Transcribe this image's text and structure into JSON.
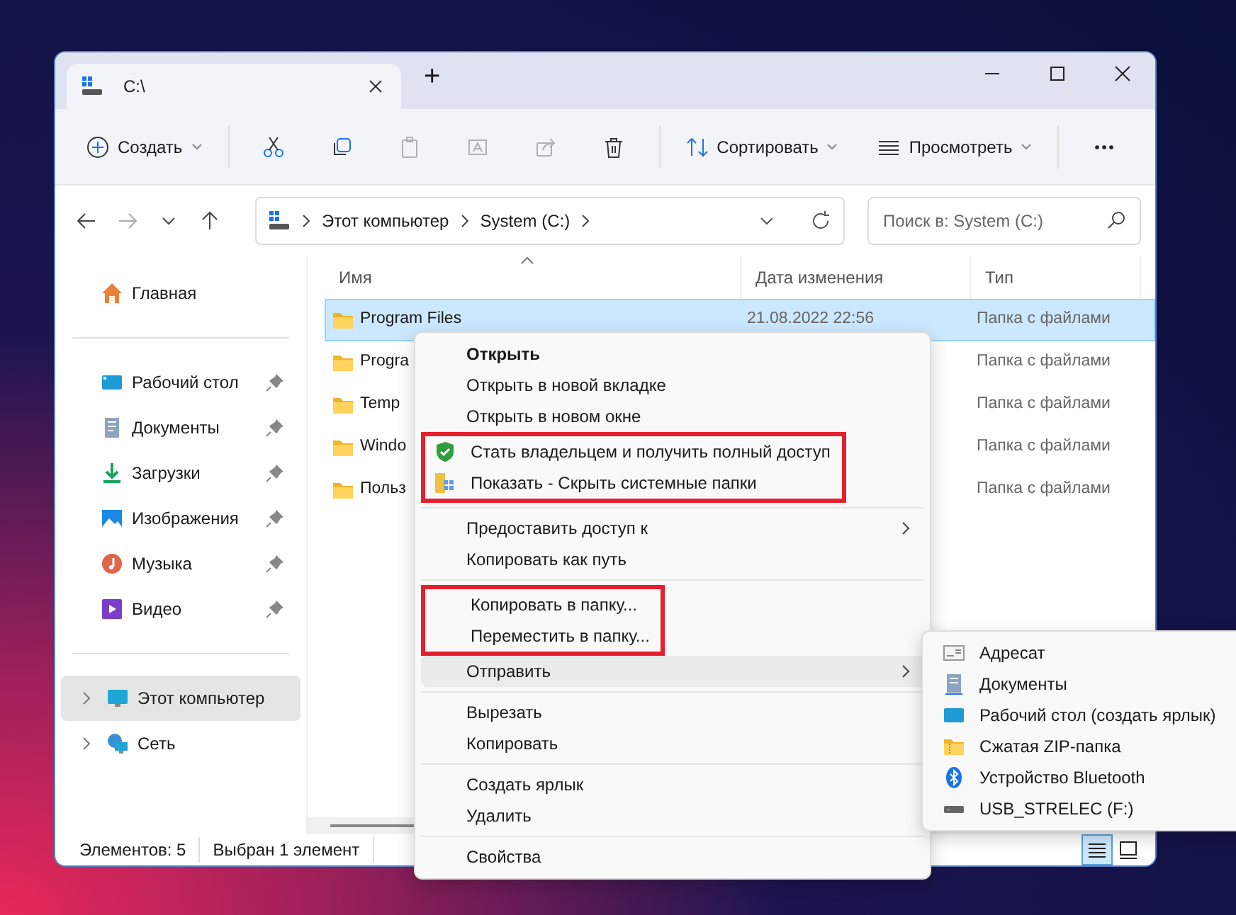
{
  "window": {
    "tab_title": "C:\\",
    "new_tab": "+"
  },
  "toolbar": {
    "create": "Создать",
    "icon_buttons": [
      {
        "disabled": false
      },
      {
        "disabled": false
      },
      {
        "disabled": true
      },
      {
        "disabled": true
      },
      {
        "disabled": true
      },
      {
        "disabled": false
      }
    ],
    "sort": "Сортировать",
    "view": "Просмотреть"
  },
  "address": {
    "crumbs": [
      "Этот компьютер",
      "System (C:)"
    ],
    "search_placeholder": "Поиск в: System (C:)"
  },
  "sidebar": {
    "sections": [
      {
        "items": [
          {
            "label": "Главная",
            "pinned": false,
            "selected": false
          }
        ]
      },
      {
        "items": [
          {
            "label": "Рабочий стол",
            "pinned": true,
            "selected": false
          },
          {
            "label": "Документы",
            "pinned": true,
            "selected": false
          },
          {
            "label": "Загрузки",
            "pinned": true,
            "selected": false
          },
          {
            "label": "Изображения",
            "pinned": true,
            "selected": false
          },
          {
            "label": "Музыка",
            "pinned": true,
            "selected": false
          },
          {
            "label": "Видео",
            "pinned": true,
            "selected": false
          }
        ]
      },
      {
        "items": [
          {
            "label": "Этот компьютер",
            "expanded": false,
            "selected": true
          },
          {
            "label": "Сеть",
            "expanded": false,
            "selected": false
          }
        ]
      }
    ]
  },
  "table": {
    "columns": [
      "Имя",
      "Дата изменения",
      "Тип"
    ],
    "rows": [
      {
        "name": "Program Files",
        "date": "21.08.2022 22:56",
        "type": "Папка с файлами",
        "selected": true
      },
      {
        "name": "Progra",
        "type": "Папка с файлами",
        "selected": false
      },
      {
        "name": "Temp",
        "type": "Папка с файлами",
        "selected": false
      },
      {
        "name": "Windo",
        "type": "Папка с файлами",
        "selected": false
      },
      {
        "name": "Польз",
        "type": "Папка с файлами",
        "selected": false
      }
    ]
  },
  "status_bar": {
    "items": "Элементов: 5",
    "selection": "Выбран 1 элемент",
    "views": [
      {
        "selected": true
      },
      {
        "selected": false
      }
    ]
  },
  "context_menu": {
    "sections": [
      {
        "items": [
          {
            "label": "Открыть",
            "default": true,
            "highlighted": false,
            "selected": false,
            "submenu": false
          },
          {
            "label": "Открыть в новой вкладке",
            "default": false,
            "highlighted": false,
            "selected": false,
            "submenu": false
          },
          {
            "label": "Открыть в новом окне",
            "default": false,
            "highlighted": false,
            "selected": false,
            "submenu": false
          },
          {
            "label": "Стать владельцем и получить полный доступ",
            "default": false,
            "highlighted": true,
            "selected": false,
            "submenu": false
          },
          {
            "label": "Показать - Скрыть системные папки",
            "default": false,
            "highlighted": true,
            "selected": false,
            "submenu": false
          }
        ]
      },
      {
        "items": [
          {
            "label": "Предоставить доступ к",
            "default": false,
            "highlighted": false,
            "selected": false,
            "submenu": true
          },
          {
            "label": "Копировать как путь",
            "default": false,
            "highlighted": false,
            "selected": false,
            "submenu": false
          }
        ]
      },
      {
        "items": [
          {
            "label": "Копировать в папку...",
            "default": false,
            "highlighted": true,
            "selected": false,
            "submenu": false
          },
          {
            "label": "Переместить в папку...",
            "default": false,
            "highlighted": true,
            "selected": false,
            "submenu": false
          },
          {
            "label": "Отправить",
            "default": false,
            "highlighted": false,
            "selected": true,
            "submenu": true
          }
        ]
      },
      {
        "items": [
          {
            "label": "Вырезать",
            "default": false,
            "highlighted": false,
            "selected": false,
            "submenu": false
          },
          {
            "label": "Копировать",
            "default": false,
            "highlighted": false,
            "selected": false,
            "submenu": false
          }
        ]
      },
      {
        "items": [
          {
            "label": "Создать ярлык",
            "default": false,
            "highlighted": false,
            "selected": false,
            "submenu": false
          },
          {
            "label": "Удалить",
            "default": false,
            "highlighted": false,
            "selected": false,
            "submenu": false
          }
        ]
      },
      {
        "items": [
          {
            "label": "Свойства",
            "default": false,
            "highlighted": false,
            "selected": false,
            "submenu": false
          }
        ]
      }
    ]
  },
  "send_to_menu": {
    "items": [
      "Адресат",
      "Документы",
      "Рабочий стол (создать ярлык)",
      "Сжатая ZIP-папка",
      "Устройство Bluetooth",
      "USB_STRELEC (F:)"
    ]
  }
}
